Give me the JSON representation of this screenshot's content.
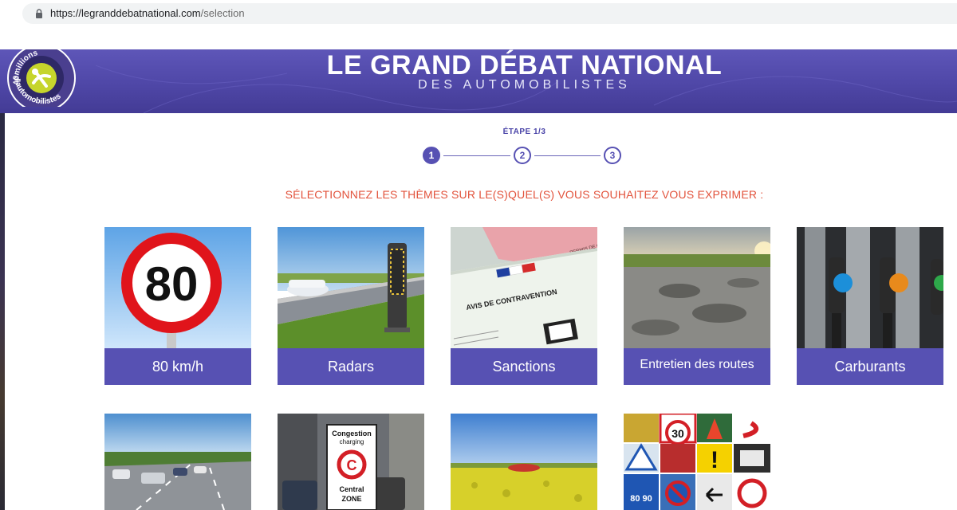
{
  "browser": {
    "url_host": "https://legranddebatnational.com",
    "url_path": "/selection"
  },
  "logo": {
    "text_top": "40millions",
    "text_bottom": "d'automobilistes"
  },
  "header": {
    "title": "LE GRAND DÉBAT NATIONAL",
    "subtitle": "DES AUTOMOBILISTES"
  },
  "steps": {
    "label": "ÉTAPE 1/3",
    "items": [
      "1",
      "2",
      "3"
    ],
    "current": 1
  },
  "instruction": "SÉLECTIONNEZ LES THÈMES SUR LE(S)QUEL(S) VOUS SOUHAITEZ VOUS EXPRIMER :",
  "themes": [
    {
      "label": "80 km/h",
      "sign_number": "80"
    },
    {
      "label": "Radars"
    },
    {
      "label": "Sanctions",
      "img_text_1": "PERMIS DE CONDU",
      "img_text_2": "AVIS DE CONTRAVENTION"
    },
    {
      "label": "Entretien des routes"
    },
    {
      "label": "Carburants"
    }
  ],
  "themes_row2": [
    {
      "name": "highway"
    },
    {
      "name": "congestion",
      "sign_line_1": "Congestion",
      "sign_line_2": "charging",
      "sign_letter": "C",
      "sign_line_3": "Central",
      "sign_line_4": "ZONE"
    },
    {
      "name": "field"
    },
    {
      "name": "road-signs",
      "sign_a": "30",
      "sign_b": "80",
      "sign_c": "90"
    }
  ],
  "colors": {
    "brand": "#5751b3",
    "accent": "#e2523b",
    "header_bg": "#4f47a7"
  }
}
